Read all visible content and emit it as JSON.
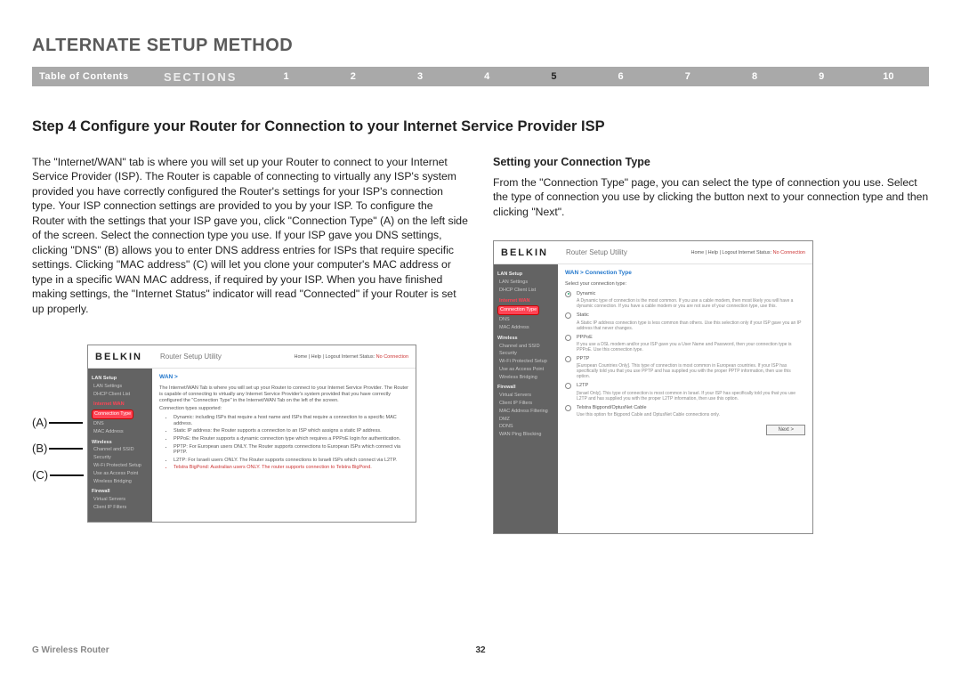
{
  "page": {
    "title": "ALTERNATE SETUP METHOD",
    "toc_label": "Table of Contents",
    "sections_label": "SECTIONS",
    "section_numbers": [
      "1",
      "2",
      "3",
      "4",
      "5",
      "6",
      "7",
      "8",
      "9",
      "10"
    ],
    "active_section": "5",
    "step_heading": "Step 4 Configure your Router for Connection to your Internet Service Provider ISP",
    "left_paragraph": "The \"Internet/WAN\" tab is where you will set up your Router to connect to your Internet Service Provider (ISP). The Router is capable of connecting to virtually any ISP's system provided you have correctly configured the Router's settings for your ISP's connection type. Your ISP connection settings are provided to you by your ISP. To configure the Router with the settings that your ISP gave you, click \"Connection Type\" (A) on the left side of the screen. Select the connection type you use. If your ISP gave you DNS settings, clicking \"DNS\" (B) allows you to enter DNS address entries for ISPs that require specific settings. Clicking \"MAC address\" (C) will let you clone your computer's MAC address or type in a specific WAN MAC address, if required by your ISP. When you have finished making settings, the \"Internet Status\" indicator will read \"Connected\" if your Router is set up properly.",
    "right_heading": "Setting your Connection Type",
    "right_paragraph": "From the \"Connection Type\" page, you can select the type of connection you use. Select the type of connection you use by clicking the button next to your connection type and then clicking \"Next\".",
    "labels": {
      "a": "(A)",
      "b": "(B)",
      "c": "(C)"
    },
    "footer_left": "G Wireless Router",
    "page_number": "32"
  },
  "shot_common": {
    "logo": "BELKIN",
    "utility": "Router Setup Utility",
    "header_links": "Home | Help | Logout   Internet Status:",
    "no_connection": "No Connection"
  },
  "shot1": {
    "breadcrumb": "WAN >",
    "intro": "The Internet/WAN Tab is where you will set up your Router to connect to your Internet Service Provider. The Router is capable of connecting to virtually any Internet Service Provider's system provided that you have correctly configured the \"Connection Type\" in the Internet/WAN Tab on the left of the screen.",
    "supported_label": "Connection types supported:",
    "bullets": [
      "Dynamic: including ISPs that require a host name and ISPs that require a connection to a specific MAC address.",
      "Static IP address: the Router supports a connection to an ISP which assigns a static IP address.",
      "PPPoE: the Router supports a dynamic connection type which requires a PPPoE login for authentication.",
      "PPTP: For European users ONLY. The Router supports connections to European ISPs which connect via PPTP.",
      "L2TP: For Israeli users ONLY. The Router supports connections to Israeli ISPs which connect via L2TP.",
      "Telstra BigPond: Australian users ONLY. The router supports connection to Telstra BigPond."
    ],
    "side": {
      "lan": "LAN Setup",
      "lan_items": [
        "LAN Settings",
        "DHCP Client List"
      ],
      "wan": "Internet WAN",
      "wan_items": [
        "Connection Type",
        "DNS",
        "MAC Address"
      ],
      "wireless": "Wireless",
      "wireless_items": [
        "Channel and SSID",
        "Security",
        "Wi-Fi Protected Setup",
        "Use as Access Point",
        "Wireless Bridging"
      ],
      "firewall": "Firewall",
      "firewall_items": [
        "Virtual Servers",
        "Client IP Filters"
      ]
    }
  },
  "shot2": {
    "breadcrumb": "WAN > Connection Type",
    "select_label": "Select your connection type:",
    "options": [
      {
        "name": "Dynamic",
        "desc": "A Dynamic type of connection is the most common. If you use a cable modem, then most likely you will have a dynamic connection. If you have a cable modem or you are not sure of your connection type, use this.",
        "selected": true
      },
      {
        "name": "Static",
        "desc": "A Static IP address connection type is less common than others. Use this selection only if your ISP gave you an IP address that never changes.",
        "selected": false
      },
      {
        "name": "PPPoE",
        "desc": "If you use a DSL modem and/or your ISP gave you a User Name and Password, then your connection type is PPPoE. Use this connection type.",
        "selected": false
      },
      {
        "name": "PPTP",
        "desc": "[European Countries Only]. This type of connection is most common in European countries. If your ISP has specifically told you that you use PPTP and has supplied you with the proper PPTP information, then use this option.",
        "selected": false
      },
      {
        "name": "L2TP",
        "desc": "[Israel Only]. This type of connection is most common in Israel. If your ISP has specifically told you that you use L2TP and has supplied you with the proper L2TP information, then use this option.",
        "selected": false
      },
      {
        "name": "Telstra Bigpond/OptusNet Cable",
        "desc": "Use this option for Bigpond Cable and OptusNet Cable connections only.",
        "selected": false
      }
    ],
    "next": "Next >",
    "side": {
      "lan": "LAN Setup",
      "lan_items": [
        "LAN Settings",
        "DHCP Client List"
      ],
      "wan": "Internet WAN",
      "wan_items": [
        "Connection Type",
        "DNS",
        "MAC Address"
      ],
      "wireless": "Wireless",
      "wireless_items": [
        "Channel and SSID",
        "Security",
        "Wi-Fi Protected Setup",
        "Use as Access Point",
        "Wireless Bridging"
      ],
      "firewall": "Firewall",
      "firewall_items": [
        "Virtual Servers",
        "Client IP Filters",
        "MAC Address Filtering",
        "DMZ",
        "DDNS",
        "WAN Ping Blocking"
      ]
    }
  }
}
